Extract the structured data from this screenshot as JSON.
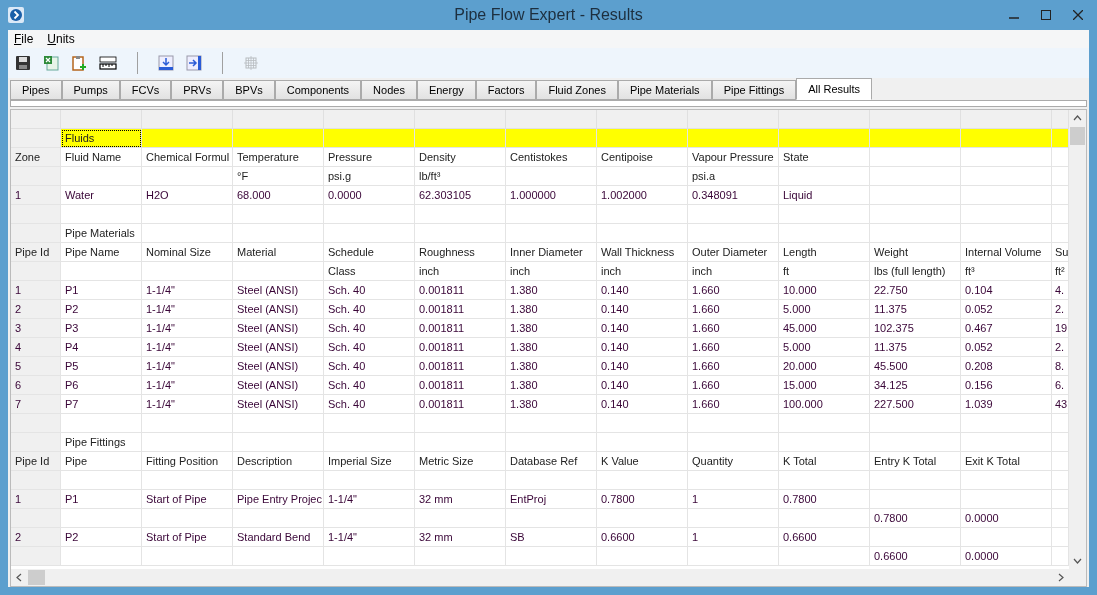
{
  "window": {
    "title": "Pipe Flow Expert - Results"
  },
  "menu": [
    "File",
    "Units"
  ],
  "toolbar": [
    {
      "kind": "save",
      "disabled": false
    },
    {
      "kind": "excel",
      "disabled": false
    },
    {
      "kind": "clipboard",
      "disabled": false
    },
    {
      "kind": "ruler",
      "disabled": false
    },
    {
      "kind": "separator"
    },
    {
      "kind": "export",
      "disabled": false
    },
    {
      "kind": "import",
      "disabled": false
    },
    {
      "kind": "separator"
    },
    {
      "kind": "grid",
      "disabled": true
    }
  ],
  "tabs": [
    {
      "label": "Pipes",
      "selected": false
    },
    {
      "label": "Pumps",
      "selected": false
    },
    {
      "label": "FCVs",
      "selected": false
    },
    {
      "label": "PRVs",
      "selected": false
    },
    {
      "label": "BPVs",
      "selected": false
    },
    {
      "label": "Components",
      "selected": false
    },
    {
      "label": "Nodes",
      "selected": false
    },
    {
      "label": "Energy",
      "selected": false
    },
    {
      "label": "Factors",
      "selected": false
    },
    {
      "label": "Fluid Zones",
      "selected": false
    },
    {
      "label": "Pipe Materials",
      "selected": false
    },
    {
      "label": "Pipe Fittings",
      "selected": false
    },
    {
      "label": "All Results",
      "selected": true
    }
  ],
  "table": {
    "rows": [
      {
        "kind": "section",
        "title": "Fluids",
        "highlighted": true,
        "focused": true
      },
      {
        "kind": "header",
        "cells": [
          "Zone",
          "Fluid Name",
          "Chemical Formul",
          "Temperature",
          "Pressure",
          "Density",
          "Centistokes",
          "Centipoise",
          "Vapour Pressure",
          "State",
          null,
          null,
          null
        ]
      },
      {
        "kind": "units",
        "cells": [
          null,
          null,
          null,
          "°F",
          "psi.g",
          "lb/ft³",
          null,
          null,
          "psi.a",
          null,
          null,
          null,
          null
        ]
      },
      {
        "kind": "data",
        "cells": [
          "1",
          "Water",
          "H2O",
          "68.000",
          "0.0000",
          "62.303105",
          "1.000000",
          "1.002000",
          "0.348091",
          "Liquid",
          null,
          null,
          null
        ]
      },
      {
        "kind": "blank"
      },
      {
        "kind": "section",
        "title": "Pipe Materials",
        "highlighted": false,
        "focused": false
      },
      {
        "kind": "header",
        "cells": [
          "Pipe Id",
          "Pipe Name",
          "Nominal Size",
          "Material",
          "Schedule",
          "Roughness",
          "Inner Diameter",
          "Wall Thickness",
          "Outer Diameter",
          "Length",
          "Weight",
          "Internal Volume",
          "Su"
        ]
      },
      {
        "kind": "units",
        "cells": [
          null,
          null,
          null,
          null,
          "Class",
          "inch",
          "inch",
          "inch",
          "inch",
          "ft",
          "lbs (full length)",
          "ft³",
          "ft²"
        ]
      },
      {
        "kind": "data",
        "cells": [
          "1",
          "P1",
          "1-1/4\"",
          "Steel (ANSI)",
          "Sch.  40",
          "0.001811",
          "1.380",
          "0.140",
          "1.660",
          "10.000",
          "22.750",
          "0.104",
          "4."
        ]
      },
      {
        "kind": "data",
        "cells": [
          "2",
          "P2",
          "1-1/4\"",
          "Steel (ANSI)",
          "Sch.  40",
          "0.001811",
          "1.380",
          "0.140",
          "1.660",
          "5.000",
          "11.375",
          "0.052",
          "2."
        ]
      },
      {
        "kind": "data",
        "cells": [
          "3",
          "P3",
          "1-1/4\"",
          "Steel (ANSI)",
          "Sch.  40",
          "0.001811",
          "1.380",
          "0.140",
          "1.660",
          "45.000",
          "102.375",
          "0.467",
          "19"
        ]
      },
      {
        "kind": "data",
        "cells": [
          "4",
          "P4",
          "1-1/4\"",
          "Steel (ANSI)",
          "Sch.  40",
          "0.001811",
          "1.380",
          "0.140",
          "1.660",
          "5.000",
          "11.375",
          "0.052",
          "2."
        ]
      },
      {
        "kind": "data",
        "cells": [
          "5",
          "P5",
          "1-1/4\"",
          "Steel (ANSI)",
          "Sch.  40",
          "0.001811",
          "1.380",
          "0.140",
          "1.660",
          "20.000",
          "45.500",
          "0.208",
          "8."
        ]
      },
      {
        "kind": "data",
        "cells": [
          "6",
          "P6",
          "1-1/4\"",
          "Steel (ANSI)",
          "Sch.  40",
          "0.001811",
          "1.380",
          "0.140",
          "1.660",
          "15.000",
          "34.125",
          "0.156",
          "6."
        ]
      },
      {
        "kind": "data",
        "cells": [
          "7",
          "P7",
          "1-1/4\"",
          "Steel (ANSI)",
          "Sch.  40",
          "0.001811",
          "1.380",
          "0.140",
          "1.660",
          "100.000",
          "227.500",
          "1.039",
          "43"
        ]
      },
      {
        "kind": "blank"
      },
      {
        "kind": "section",
        "title": "Pipe Fittings",
        "highlighted": false,
        "focused": false
      },
      {
        "kind": "header",
        "cells": [
          "Pipe Id",
          "Pipe",
          "Fitting Position",
          "Description",
          "Imperial Size",
          "Metric Size",
          "Database Ref",
          "K Value",
          "Quantity",
          "K Total",
          "Entry K Total",
          "Exit K Total",
          null
        ]
      },
      {
        "kind": "blank"
      },
      {
        "kind": "data",
        "cells": [
          "1",
          "P1",
          "Start of Pipe",
          "Pipe Entry Projec",
          "1-1/4\"",
          "32 mm",
          "EntProj",
          "0.7800",
          "1",
          "0.7800",
          null,
          null,
          null
        ]
      },
      {
        "kind": "data",
        "cells": [
          null,
          null,
          null,
          null,
          null,
          null,
          null,
          null,
          null,
          null,
          "0.7800",
          "0.0000",
          null
        ]
      },
      {
        "kind": "data",
        "cells": [
          "2",
          "P2",
          "Start of Pipe",
          "Standard Bend",
          "1-1/4\"",
          "32 mm",
          "SB",
          "0.6600",
          "1",
          "0.6600",
          null,
          null,
          null
        ]
      },
      {
        "kind": "data",
        "cells": [
          null,
          null,
          null,
          null,
          null,
          null,
          null,
          null,
          null,
          null,
          "0.6600",
          "0.0000",
          null
        ]
      }
    ]
  }
}
